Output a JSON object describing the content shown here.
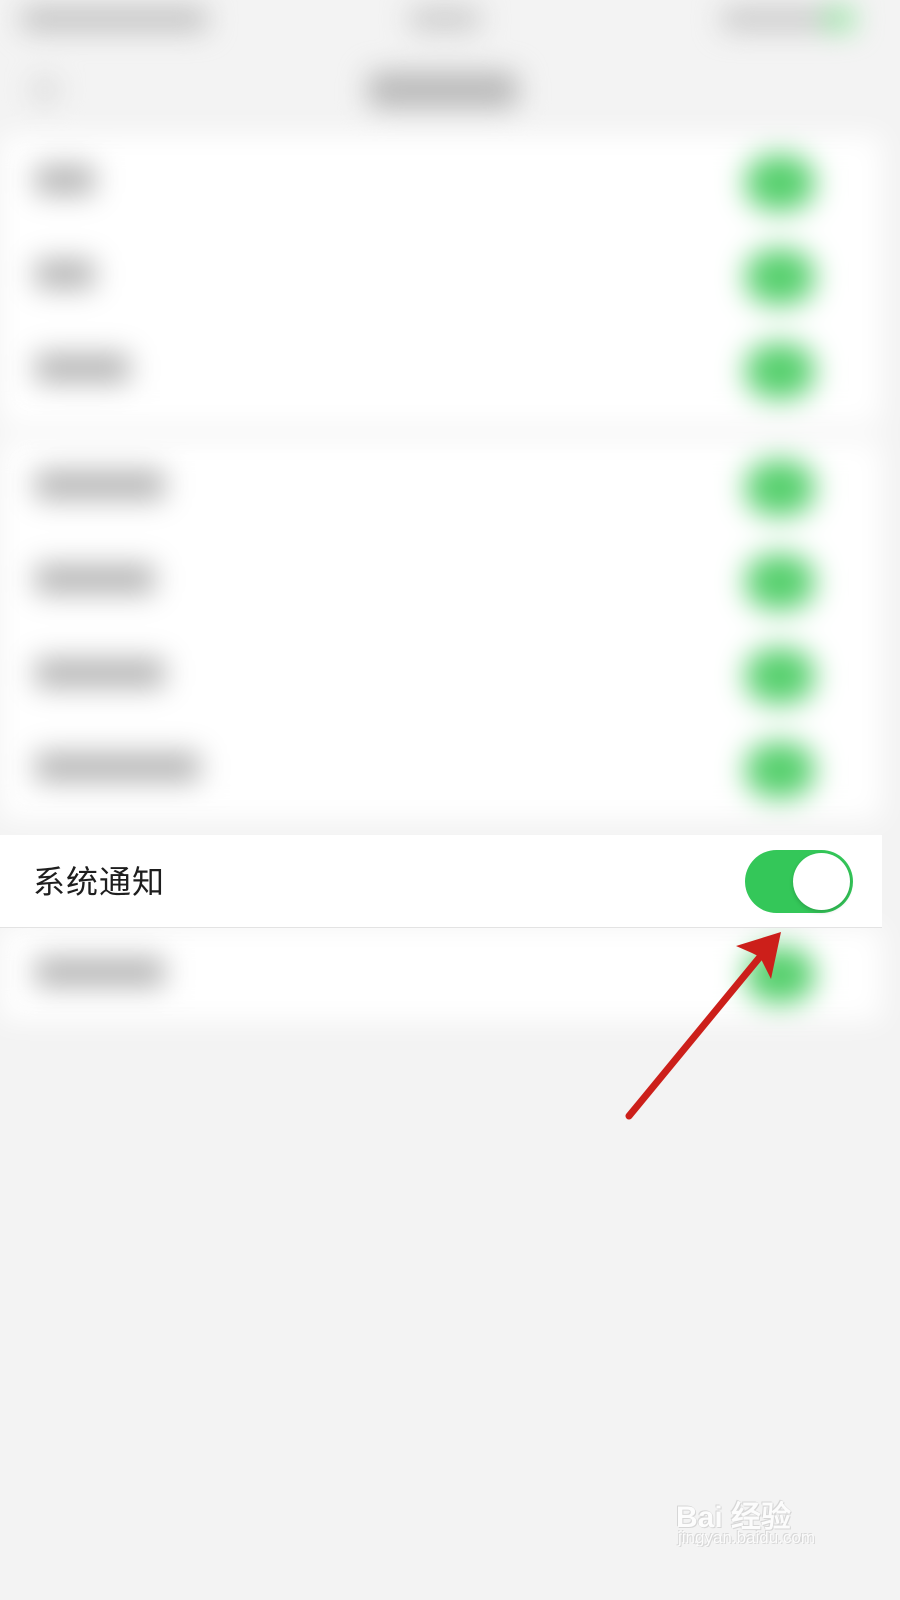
{
  "settings": {
    "rows": [
      {
        "label": "系统通知",
        "enabled": true
      }
    ]
  },
  "watermark": {
    "brand": "Bai 经验",
    "url": "jingyan.baidu.com"
  },
  "colors": {
    "toggle_on": "#34c759",
    "arrow": "#cc1f1a",
    "background": "#f3f3f3"
  }
}
